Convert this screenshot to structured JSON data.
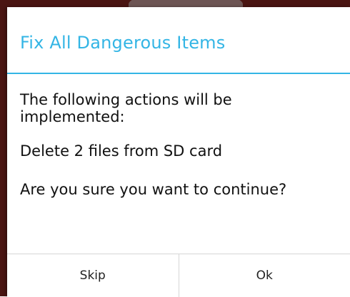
{
  "dialog": {
    "title": "Fix All Dangerous Items",
    "message_intro": "The following actions will be implemented:",
    "action_item": "Delete 2 files from SD card",
    "confirm_question": "Are you sure you want to continue?",
    "buttons": {
      "skip_label": "Skip",
      "ok_label": "Ok"
    }
  },
  "colors": {
    "accent": "#33b5e5",
    "backdrop": "#4a1512",
    "dialog_background": "#ffffff",
    "divider": "#d6d6d6"
  }
}
